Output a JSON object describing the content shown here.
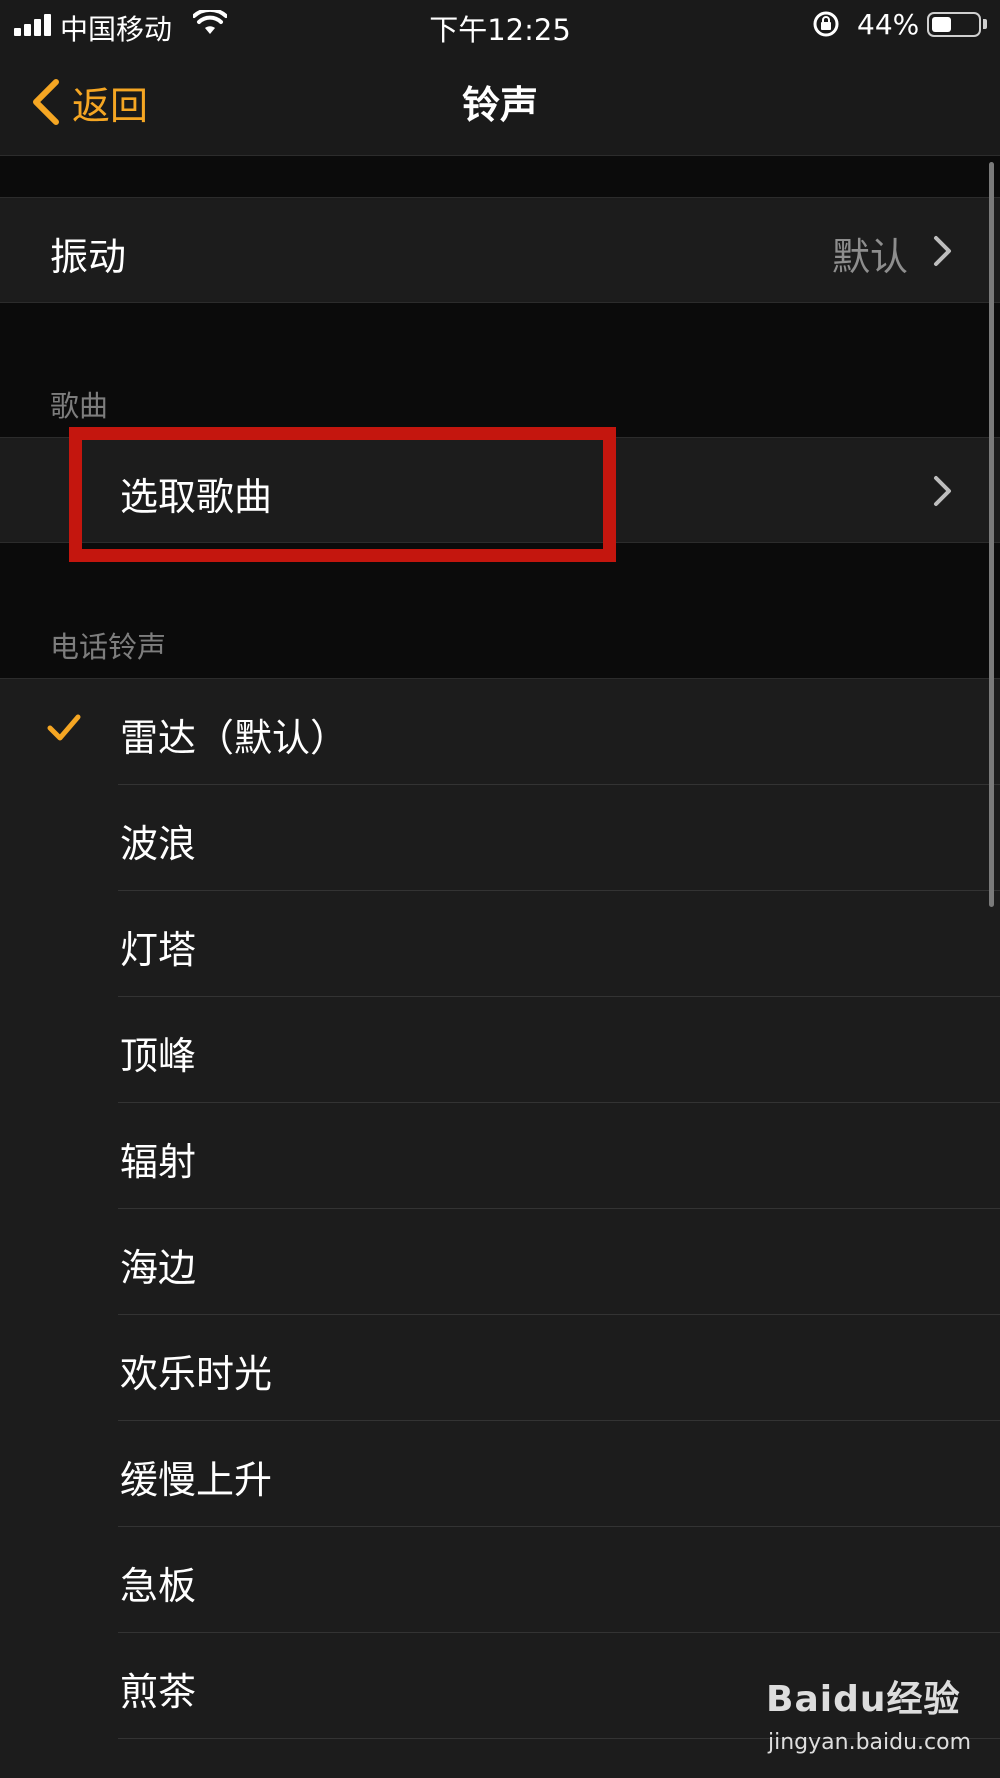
{
  "status_bar": {
    "carrier": "中国移动",
    "time": "下午12:25",
    "battery_percent_label": "44%",
    "battery_level": 0.44
  },
  "nav": {
    "back_label": "返回",
    "title": "铃声"
  },
  "vibration": {
    "label": "振动",
    "value": "默认"
  },
  "songs_section": {
    "header": "歌曲",
    "pick_song_label": "选取歌曲"
  },
  "ringtones_section": {
    "header": "电话铃声",
    "items": [
      {
        "label": "雷达（默认）",
        "selected": true
      },
      {
        "label": "波浪",
        "selected": false
      },
      {
        "label": "灯塔",
        "selected": false
      },
      {
        "label": "顶峰",
        "selected": false
      },
      {
        "label": "辐射",
        "selected": false
      },
      {
        "label": "海边",
        "selected": false
      },
      {
        "label": "欢乐时光",
        "selected": false
      },
      {
        "label": "缓慢上升",
        "selected": false
      },
      {
        "label": "急板",
        "selected": false
      },
      {
        "label": "煎茶",
        "selected": false
      }
    ]
  },
  "colors": {
    "accent": "#f5a623",
    "highlight": "#c4160e"
  },
  "watermark": {
    "brand": "Baidu经验",
    "url": "jingyan.baidu.com"
  }
}
